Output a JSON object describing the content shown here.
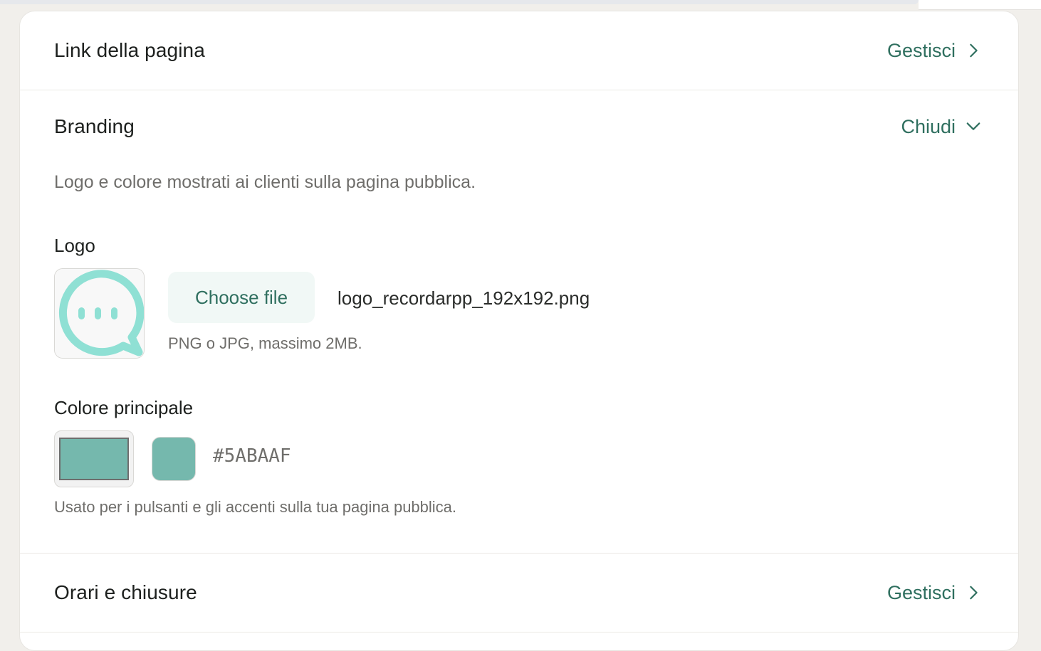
{
  "page_link": {
    "title": "Link della pagina",
    "action": "Gestisci"
  },
  "branding": {
    "title": "Branding",
    "action": "Chiudi",
    "description": "Logo e colore mostrati ai clienti sulla pagina pubblica.",
    "logo": {
      "label": "Logo",
      "choose_label": "Choose file",
      "filename": "logo_recordarpp_192x192.png",
      "hint": "PNG o JPG, massimo 2MB.",
      "preview_color": "#8fe0d4"
    },
    "color": {
      "label": "Colore principale",
      "value": "#5ABAAF",
      "swatch_hex": "#75b8ad",
      "hint": "Usato per i pulsanti e gli accenti sulla tua pagina pubblica."
    }
  },
  "hours": {
    "title": "Orari e chiusure",
    "action": "Gestisci"
  },
  "colors": {
    "accent": "#2f6f5f"
  }
}
